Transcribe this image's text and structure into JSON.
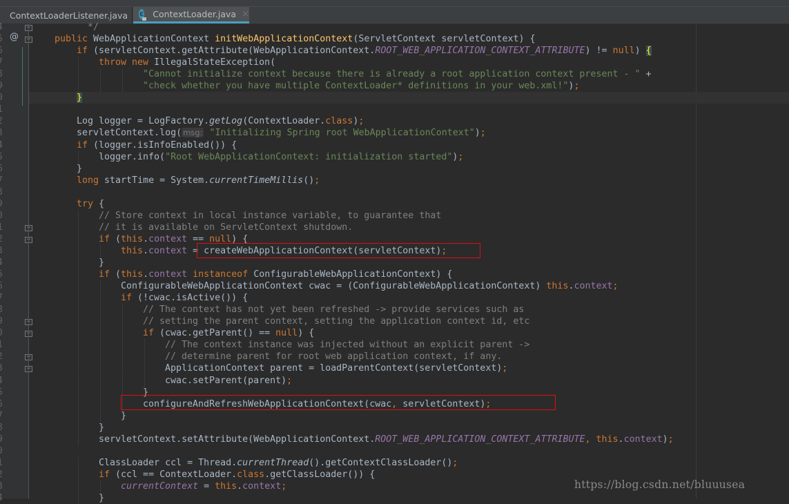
{
  "tabs": [
    {
      "label": "ContextLoaderListener.java",
      "active": false,
      "icon": "java-class-icon"
    },
    {
      "label": "ContextLoader.java",
      "active": true,
      "icon": "java-class-locked-icon"
    }
  ],
  "tab_close_glyph": "×",
  "gutter": {
    "line_number_digits": [
      "4",
      "5",
      "6",
      "7",
      "8",
      "9",
      "0",
      "1",
      "2",
      "3",
      "4",
      "5",
      "6",
      "7",
      "8",
      "9",
      "0",
      "1",
      "2",
      "3",
      "4",
      "5",
      "6",
      "7",
      "8",
      "9",
      "0",
      "1",
      "2",
      "3",
      "4",
      "5",
      "6",
      "7",
      "8",
      "9",
      "0",
      "1",
      "2",
      "3",
      "4"
    ],
    "override_marker": "@",
    "override_marker_line": 1
  },
  "editor": {
    "caret_line": 6,
    "highlighted_lines": [
      {
        "line": 19,
        "label": "createWebApplicationContext(servletContext);"
      },
      {
        "line": 32,
        "label": "configureAndRefreshWebApplicationContext(cwac, servletContext);"
      }
    ],
    "lines": [
      [
        [
          1,
          ""
        ],
        [
          "cm",
          "  */"
        ]
      ],
      [
        [
          0,
          ""
        ],
        [
          "kw",
          "public "
        ],
        [
          "",
          "WebApplicationContext "
        ],
        [
          "fn",
          "initWebApplicationContext"
        ],
        [
          "",
          "(ServletContext servletContext) {"
        ]
      ],
      [
        [
          1,
          ""
        ],
        [
          "kw",
          "if "
        ],
        [
          "",
          "(servletContext.getAttribute(WebApplicationContext."
        ],
        [
          "ifld",
          "ROOT_WEB_APPLICATION_CONTEXT_ATTRIBUTE"
        ],
        [
          "",
          ") != "
        ],
        [
          "kw",
          "null"
        ],
        [
          "",
          ") "
        ],
        [
          "brace",
          "{"
        ]
      ],
      [
        [
          2,
          ""
        ],
        [
          "kw",
          "throw new "
        ],
        [
          "",
          "IllegalStateException("
        ]
      ],
      [
        [
          4,
          ""
        ],
        [
          "str",
          "\"Cannot initialize context because there is already a root application context present - \""
        ],
        [
          "",
          " +"
        ]
      ],
      [
        [
          4,
          ""
        ],
        [
          "str",
          "\"check whether you have multiple ContextLoader* definitions in your web.xml!\""
        ],
        [
          "",
          ")"
        ],
        [
          "kw",
          ";"
        ]
      ],
      [
        [
          1,
          ""
        ],
        [
          "brace",
          "}"
        ]
      ],
      [
        [
          0,
          ""
        ]
      ],
      [
        [
          1,
          ""
        ],
        [
          "",
          "Log logger = LogFactory."
        ],
        [
          "ital",
          "getLog"
        ],
        [
          "",
          "(ContextLoader."
        ],
        [
          "kw",
          "class"
        ],
        [
          "",
          ")"
        ],
        [
          "kw",
          ";"
        ]
      ],
      [
        [
          1,
          ""
        ],
        [
          "",
          "servletContext.log("
        ],
        [
          "hint",
          "msg:"
        ],
        [
          "",
          " "
        ],
        [
          "str",
          "\"Initializing Spring root WebApplicationContext\""
        ],
        [
          "",
          ")"
        ],
        [
          "kw",
          ";"
        ]
      ],
      [
        [
          1,
          ""
        ],
        [
          "kw",
          "if "
        ],
        [
          "",
          "(logger.isInfoEnabled()) {"
        ]
      ],
      [
        [
          2,
          ""
        ],
        [
          "",
          "logger.info("
        ],
        [
          "str",
          "\"Root WebApplicationContext: initialization started\""
        ],
        [
          "",
          ")"
        ],
        [
          "kw",
          ";"
        ]
      ],
      [
        [
          1,
          ""
        ],
        [
          "",
          "}"
        ]
      ],
      [
        [
          1,
          ""
        ],
        [
          "kw",
          "long "
        ],
        [
          "",
          "startTime = System."
        ],
        [
          "ital",
          "currentTimeMillis"
        ],
        [
          "",
          "()"
        ],
        [
          "kw",
          ";"
        ]
      ],
      [
        [
          0,
          ""
        ]
      ],
      [
        [
          1,
          ""
        ],
        [
          "kw",
          "try "
        ],
        [
          "",
          "{"
        ]
      ],
      [
        [
          2,
          ""
        ],
        [
          "cm",
          "// Store context in local instance variable, to guarantee that"
        ]
      ],
      [
        [
          2,
          ""
        ],
        [
          "cm",
          "// it is available on ServletContext shutdown."
        ]
      ],
      [
        [
          2,
          ""
        ],
        [
          "kw",
          "if "
        ],
        [
          "",
          "("
        ],
        [
          "kw",
          "this"
        ],
        [
          "",
          "."
        ],
        [
          "fld",
          "context"
        ],
        [
          "",
          " == "
        ],
        [
          "kw",
          "null"
        ],
        [
          "",
          ") {"
        ]
      ],
      [
        [
          3,
          ""
        ],
        [
          "kw",
          "this"
        ],
        [
          "",
          "."
        ],
        [
          "fld",
          "context"
        ],
        [
          "",
          " = createWebApplicationContext(servletContext)"
        ],
        [
          "kw",
          ";"
        ]
      ],
      [
        [
          2,
          ""
        ],
        [
          "",
          "}"
        ]
      ],
      [
        [
          2,
          ""
        ],
        [
          "kw",
          "if "
        ],
        [
          "",
          "("
        ],
        [
          "kw",
          "this"
        ],
        [
          "",
          "."
        ],
        [
          "fld",
          "context "
        ],
        [
          "kw",
          "instanceof "
        ],
        [
          "",
          "ConfigurableWebApplicationContext) {"
        ]
      ],
      [
        [
          3,
          ""
        ],
        [
          "",
          "ConfigurableWebApplicationContext cwac = (ConfigurableWebApplicationContext) "
        ],
        [
          "kw",
          "this"
        ],
        [
          "",
          "."
        ],
        [
          "fld",
          "context"
        ],
        [
          "kw",
          ";"
        ]
      ],
      [
        [
          3,
          ""
        ],
        [
          "kw",
          "if "
        ],
        [
          "",
          "(!cwac.isActive()) {"
        ]
      ],
      [
        [
          4,
          ""
        ],
        [
          "cm",
          "// The context has not yet been refreshed -> provide services such as"
        ]
      ],
      [
        [
          4,
          ""
        ],
        [
          "cm",
          "// setting the parent context, setting the application context id, etc"
        ]
      ],
      [
        [
          4,
          ""
        ],
        [
          "kw",
          "if "
        ],
        [
          "",
          "(cwac.getParent() == "
        ],
        [
          "kw",
          "null"
        ],
        [
          "",
          ") {"
        ]
      ],
      [
        [
          5,
          ""
        ],
        [
          "cm",
          "// The context instance was injected without an explicit parent ->"
        ]
      ],
      [
        [
          5,
          ""
        ],
        [
          "cm",
          "// determine parent for root web application context, if any."
        ]
      ],
      [
        [
          5,
          ""
        ],
        [
          "",
          "ApplicationContext parent = loadParentContext(servletContext)"
        ],
        [
          "kw",
          ";"
        ]
      ],
      [
        [
          5,
          ""
        ],
        [
          "",
          "cwac.setParent(parent)"
        ],
        [
          "kw",
          ";"
        ]
      ],
      [
        [
          4,
          ""
        ],
        [
          "",
          "}"
        ]
      ],
      [
        [
          4,
          ""
        ],
        [
          "",
          "configureAndRefreshWebApplicationContext(cwac"
        ],
        [
          "kw",
          ","
        ],
        [
          "",
          " servletContext)"
        ],
        [
          "kw",
          ";"
        ]
      ],
      [
        [
          3,
          ""
        ],
        [
          "",
          "}"
        ]
      ],
      [
        [
          2,
          ""
        ],
        [
          "",
          "}"
        ]
      ],
      [
        [
          2,
          ""
        ],
        [
          "",
          "servletContext.setAttribute(WebApplicationContext."
        ],
        [
          "ifld",
          "ROOT_WEB_APPLICATION_CONTEXT_ATTRIBUTE"
        ],
        [
          "kw",
          ", "
        ],
        [
          "kw",
          "this"
        ],
        [
          "",
          "."
        ],
        [
          "fld",
          "context"
        ],
        [
          "",
          ")"
        ],
        [
          "kw",
          ";"
        ]
      ],
      [
        [
          0,
          ""
        ]
      ],
      [
        [
          2,
          ""
        ],
        [
          "",
          "ClassLoader ccl = Thread."
        ],
        [
          "ital",
          "currentThread"
        ],
        [
          "",
          "().getContextClassLoader()"
        ],
        [
          "kw",
          ";"
        ]
      ],
      [
        [
          2,
          ""
        ],
        [
          "kw",
          "if "
        ],
        [
          "",
          "(ccl == ContextLoader."
        ],
        [
          "kw",
          "class"
        ],
        [
          "",
          ".getClassLoader()) {"
        ]
      ],
      [
        [
          3,
          ""
        ],
        [
          "ifld",
          "currentContext"
        ],
        [
          "",
          " = "
        ],
        [
          "kw",
          "this"
        ],
        [
          "",
          "."
        ],
        [
          "fld",
          "context"
        ],
        [
          "kw",
          ";"
        ]
      ],
      [
        [
          2,
          ""
        ],
        [
          "",
          "}"
        ]
      ]
    ]
  },
  "watermark": "https://blog.csdn.net/bluuusea"
}
